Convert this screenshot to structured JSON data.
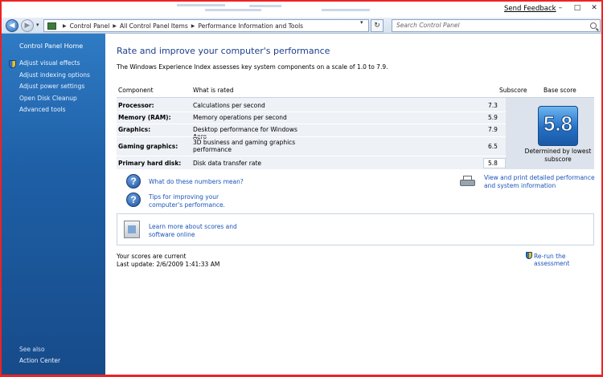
{
  "header": {
    "send_feedback": "Send Feedback",
    "min_label": "–",
    "max_label": "□",
    "close_label": "✕"
  },
  "address_bar": {
    "breadcrumbs": [
      "Control Panel",
      "All Control Panel Items",
      "Performance Information and Tools"
    ],
    "search_placeholder": "Search Control Panel"
  },
  "sidebar": {
    "home": "Control Panel Home",
    "items": [
      {
        "label": "Adjust visual effects",
        "icon": "shield-icon"
      },
      {
        "label": "Adjust indexing options"
      },
      {
        "label": "Adjust power settings"
      },
      {
        "label": "Open Disk Cleanup"
      },
      {
        "label": "Advanced tools"
      }
    ],
    "see_also": "See also",
    "action_center": "Action Center"
  },
  "main": {
    "title": "Rate and improve your computer's performance",
    "description": "The Windows Experience Index assesses key system components on a scale of 1.0 to 7.9.",
    "columns": {
      "component": "Component",
      "what_is_rated": "What is rated",
      "subscore": "Subscore",
      "base_score": "Base score"
    },
    "rows": [
      {
        "component": "Processor:",
        "rated": "Calculations per second",
        "subscore": "7.3"
      },
      {
        "component": "Memory (RAM):",
        "rated": "Memory operations per second",
        "subscore": "5.9"
      },
      {
        "component": "Graphics:",
        "rated": "Desktop performance for Windows Aero",
        "subscore": "7.9"
      },
      {
        "component": "Gaming graphics:",
        "rated": "3D business and gaming graphics performance",
        "subscore": "6.5"
      },
      {
        "component": "Primary hard disk:",
        "rated": "Disk data transfer rate",
        "subscore": "5.8"
      }
    ],
    "base_score": "5.8",
    "base_caption": "Determined by lowest subscore",
    "links": {
      "what_mean": "What do these numbers mean?",
      "tips": "Tips for improving your computer's performance.",
      "view_print": "View and print detailed performance and system information",
      "learn_more": "Learn more about scores and software online"
    },
    "status_current": "Your scores are current",
    "last_update": "Last update: 2/6/2009 1:41:33 AM",
    "rerun": "Re-run the assessment"
  }
}
